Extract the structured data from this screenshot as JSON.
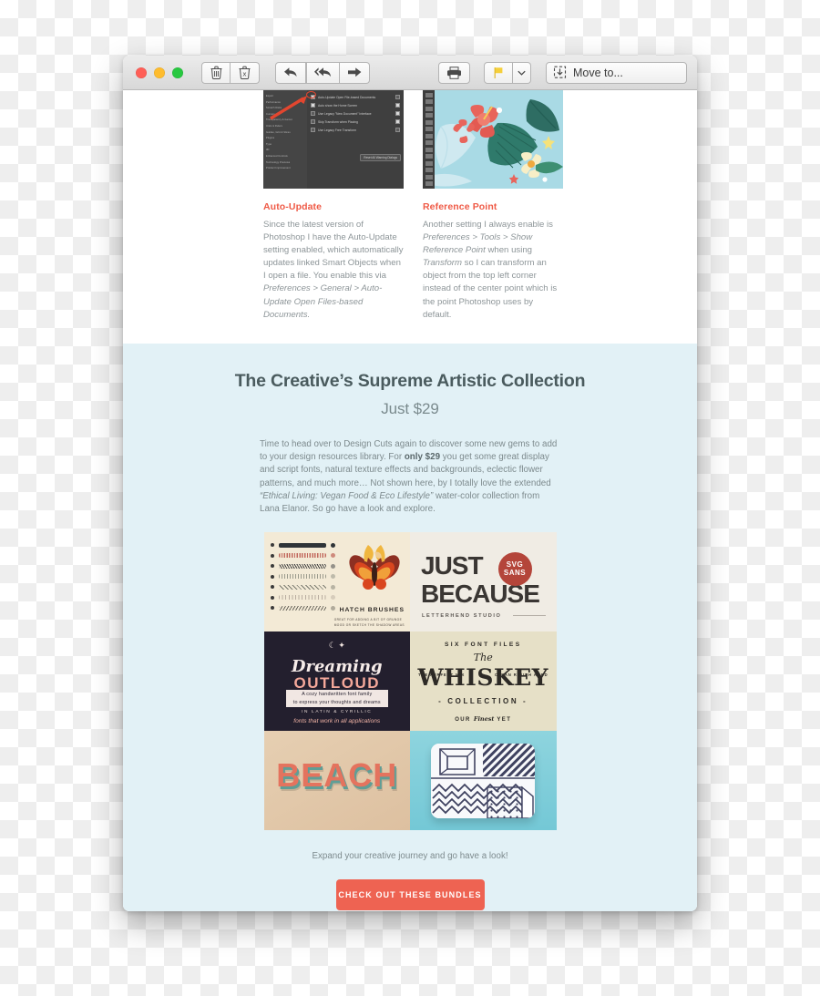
{
  "window": {
    "traffic_lights": [
      "close",
      "minimize",
      "maximize"
    ],
    "toolbar": {
      "delete_label": "",
      "junk_label": "",
      "reply_label": "",
      "reply_all_label": "",
      "forward_label": "",
      "print_label": "",
      "flag_label": "",
      "flag_menu_label": "⌄",
      "move_to_label": "Move to..."
    }
  },
  "article": {
    "columns": [
      {
        "thumb": "photoshop-preferences-screenshot",
        "heading": "Auto-Update",
        "body_html": "Since the latest version of Photoshop I have the Auto-Update setting enabled, which automatically updates linked Smart Objects when I open a file. You enable this via <em>Preferences &gt; General &gt; Auto-Update Open Files-based Documents.</em>"
      },
      {
        "thumb": "tropical-floral-illustration",
        "heading": "Reference Point",
        "body_html": "Another setting I always enable is <em>Preferences &gt; Tools &gt; Show Reference Point</em> when using <em>Transform</em> so I can transform an object from the top left corner instead of the center point which is the point Photoshop uses by default."
      }
    ],
    "prefs_panel": {
      "sidebar_items": [
        "Export",
        "Performance",
        "Scratch Disks",
        "Cursors",
        "Transparency & Gamut",
        "Units & Rulers",
        "Guides, Grid & Slices",
        "Plugins",
        "Type",
        "3D",
        "Enhanced Controls",
        "Technology Previews",
        "Product Improvement"
      ],
      "checkbox_rows": [
        {
          "label": "Auto-Update Open File-based Documents",
          "checked": true,
          "right_checked": false
        },
        {
          "label": "Auto show the Home Screen",
          "checked": true,
          "right_checked": true
        },
        {
          "label": "Use Legacy \"New Document\" Interface",
          "checked": false,
          "right_checked": true
        },
        {
          "label": "Skip Transform when Placing",
          "checked": false,
          "right_checked": true
        },
        {
          "label": "Use Legacy Free Transform",
          "checked": false,
          "right_checked": false
        }
      ],
      "reset_button": "Reset All Warning Dialogs"
    }
  },
  "promo": {
    "title": "The Creative’s Supreme Artistic Collection",
    "price": "Just $29",
    "body_html": "Time to head over to Design Cuts again to discover some new gems to add to your design resources library. For <b>only $29</b> you get some great display and script fonts, natural texture effects and backgrounds, eclectic flower patterns, and much more… Not shown here, by I totally love the extended <em>“Ethical Living: Vegan Food &amp; Eco Lifestyle”</em> water-color collection from Lana Elanor. So go have a look and explore.",
    "background_color": "#e2f1f6",
    "accent_color": "#ee6352",
    "cta_line": "Expand your creative journey and go have a look!",
    "cta_button": "CHECK OUT THESE BUNDLES",
    "products": [
      {
        "name": "hatch-brushes",
        "title": "HATCH BRUSHES",
        "subtitle_line1": "GREAT FOR ADDING A BIT OF GRUNGE",
        "subtitle_line2": "MOOD OR SKETCH THE SHADOW AREAS"
      },
      {
        "name": "just-because",
        "word1": "JUST",
        "word2": "BECAUSE",
        "badge_line1": "SVG",
        "badge_line2": "SANS",
        "footer": "LETTERHEND STUDIO"
      },
      {
        "name": "dreaming-outloud",
        "word1": "Dreaming",
        "word2": "OUTLOUD",
        "band1": "A cozy handwritten font family",
        "band2": "to express your thoughts and dreams",
        "script_line": "IN LATIN & CYRILLIC",
        "footer": "fonts that work in all applications"
      },
      {
        "name": "whiskey-collection",
        "arc": "SIX FONT FILES",
        "the": "The",
        "main": "WHISKEY",
        "collection": "- COLLECTION -",
        "footer_pre": "OUR",
        "footer_script": "Finest",
        "footer_post": "YET",
        "left_badge": "THE PERFECT MIX",
        "right_badge": "CLEAN ROUGH AGED"
      },
      {
        "name": "beach-text-effect",
        "title": "BEACH"
      },
      {
        "name": "geometric-pillow-mockup",
        "title": ""
      }
    ]
  }
}
